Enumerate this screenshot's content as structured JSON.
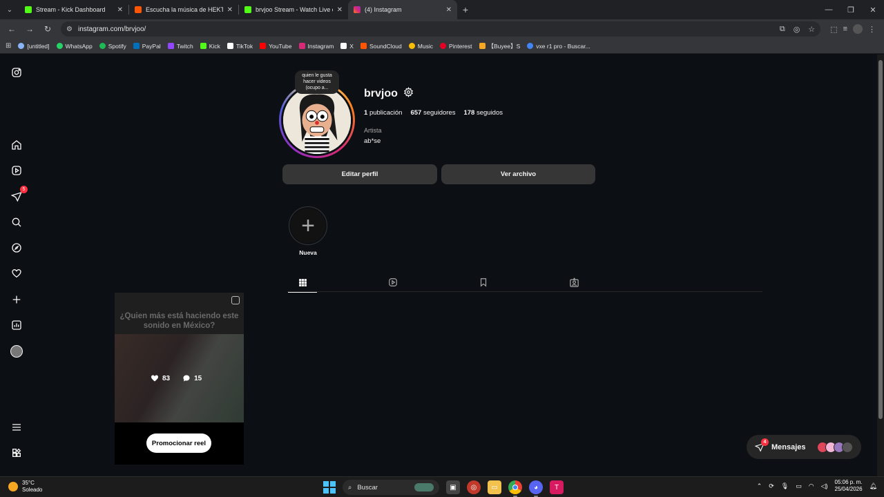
{
  "browser": {
    "tabs": [
      {
        "title": "Stream - Kick Dashboard",
        "color": "#53fc18",
        "active": false
      },
      {
        "title": "Escucha la música de HEKTORP",
        "color": "#ff5500",
        "active": false
      },
      {
        "title": "brvjoo Stream - Watch Live on",
        "color": "#53fc18",
        "active": false
      },
      {
        "title": "(4) Instagram",
        "color": "#d62976",
        "active": true
      }
    ],
    "url": "instagram.com/brvjoo/",
    "bookmarks": [
      {
        "label": "[untitled]",
        "color": "#8ab4f8"
      },
      {
        "label": "WhatsApp",
        "color": "#25d366"
      },
      {
        "label": "Spotify",
        "color": "#1db954"
      },
      {
        "label": "PayPal",
        "color": "#0070ba"
      },
      {
        "label": "Twitch",
        "color": "#9146ff"
      },
      {
        "label": "Kick",
        "color": "#53fc18"
      },
      {
        "label": "TikTok",
        "color": "#ffffff"
      },
      {
        "label": "YouTube",
        "color": "#ff0000"
      },
      {
        "label": "Instagram",
        "color": "#d62976"
      },
      {
        "label": "X",
        "color": "#ffffff"
      },
      {
        "label": "SoundCloud",
        "color": "#ff5500"
      },
      {
        "label": "Music",
        "color": "#fbbc04"
      },
      {
        "label": "Pinterest",
        "color": "#e60023"
      },
      {
        "label": "【Buyee】S",
        "color": "#f5a623"
      },
      {
        "label": "vxe r1 pro - Buscar...",
        "color": "#4285f4"
      }
    ]
  },
  "sidebar": {
    "icons": [
      "instagram-logo-icon",
      "home-icon",
      "reels-icon",
      "messages-icon",
      "search-icon",
      "explore-icon",
      "notifications-icon",
      "create-icon",
      "dashboard-icon",
      "profile-avatar",
      "menu-icon",
      "more-apps-icon"
    ],
    "messages_badge": "5"
  },
  "profile": {
    "note": "quien le gusta hacer videos (ocupo a...",
    "username": "brvjoo",
    "posts_count": "1",
    "posts_label": "publicación",
    "followers_count": "657",
    "followers_label": "seguidores",
    "following_count": "178",
    "following_label": "seguidos",
    "category": "Artista",
    "bio": "ab*se",
    "edit_button": "Editar perfil",
    "archive_button": "Ver archivo",
    "highlight_new_label": "Nueva"
  },
  "post": {
    "caption": "¿Quien más está haciendo este sonido en México?",
    "likes": "83",
    "comments": "15",
    "promote_label": "Promocionar reel"
  },
  "messages_bar": {
    "label": "Mensajes",
    "badge": "4"
  },
  "taskbar": {
    "temperature": "35°C",
    "weather": "Soleado",
    "search_placeholder": "Buscar",
    "time": "05:06 p. m.",
    "date": "25/04/2026"
  }
}
